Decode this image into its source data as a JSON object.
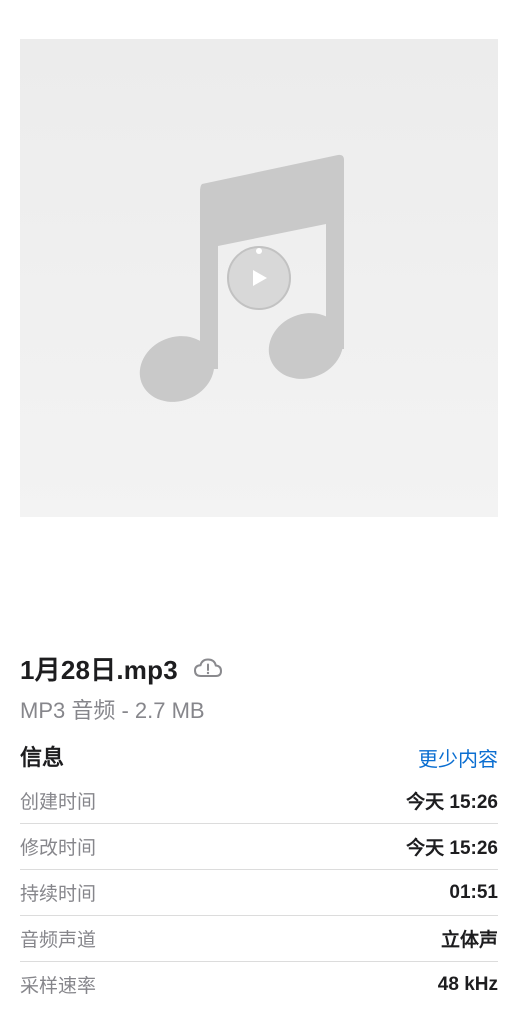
{
  "file": {
    "title": "1月28日.mp3",
    "subtitle": "MP3 音频 - 2.7 MB",
    "cloud_icon": "cloud-warning-icon",
    "artwork_icon": "music-note-icon",
    "play_icon": "play-icon"
  },
  "info": {
    "title": "信息",
    "toggle_label": "更少内容",
    "rows": [
      {
        "label": "创建时间",
        "value": "今天 15:26"
      },
      {
        "label": "修改时间",
        "value": "今天 15:26"
      },
      {
        "label": "持续时间",
        "value": "01:51"
      },
      {
        "label": "音频声道",
        "value": "立体声"
      },
      {
        "label": "采样速率",
        "value": "48 kHz"
      }
    ]
  },
  "colors": {
    "link": "#0a6ed1",
    "secondary_text": "#86868b",
    "artwork_bg": "#efefef",
    "note": "#c9c9c9"
  }
}
